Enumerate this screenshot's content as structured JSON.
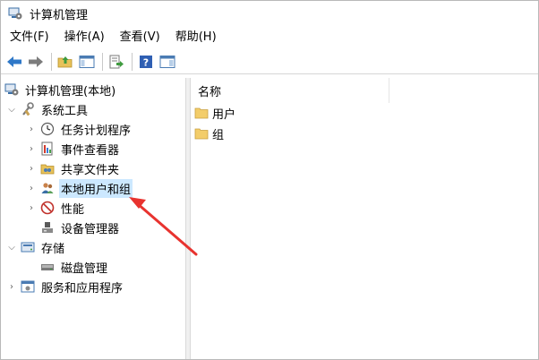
{
  "window": {
    "title": "计算机管理",
    "icon": "computer-management-icon"
  },
  "menu": [
    {
      "label": "文件(F)"
    },
    {
      "label": "操作(A)"
    },
    {
      "label": "查看(V)"
    },
    {
      "label": "帮助(H)"
    }
  ],
  "toolbar": {
    "icons": [
      "back-arrow-icon",
      "forward-arrow-icon",
      "up-folder-icon",
      "show-tree-icon",
      "export-list-icon",
      "help-icon",
      "properties-icon"
    ]
  },
  "tree": {
    "root": "计算机管理(本地)",
    "system_tools": "系统工具",
    "task_scheduler": "任务计划程序",
    "event_viewer": "事件查看器",
    "shared_folders": "共享文件夹",
    "local_users_groups": "本地用户和组",
    "performance": "性能",
    "device_manager": "设备管理器",
    "storage": "存储",
    "disk_management": "磁盘管理",
    "services_apps": "服务和应用程序"
  },
  "list": {
    "column_name": "名称",
    "items": [
      {
        "label": "用户"
      },
      {
        "label": "组"
      }
    ]
  },
  "colors": {
    "accent_arrow": "#e8332f",
    "selection": "#cce8ff",
    "folder": "#f3cd6a"
  }
}
